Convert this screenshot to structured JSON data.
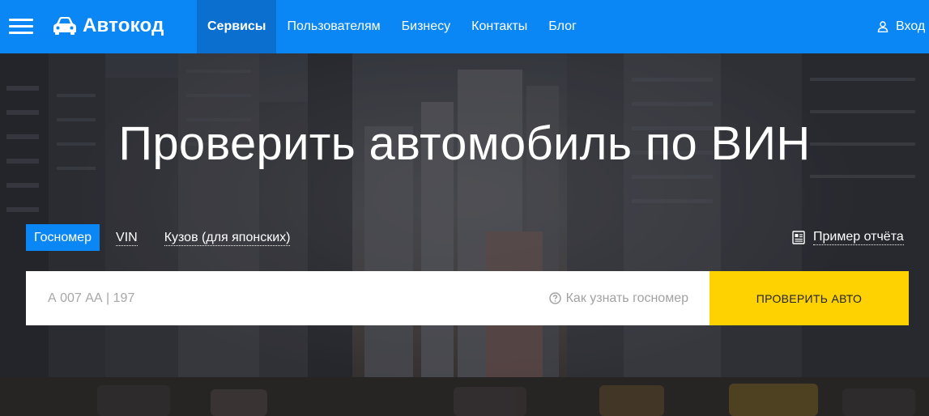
{
  "header": {
    "brand": "Автокод",
    "nav": [
      {
        "label": "Сервисы",
        "active": true
      },
      {
        "label": "Пользователям",
        "active": false
      },
      {
        "label": "Бизнесу",
        "active": false
      },
      {
        "label": "Контакты",
        "active": false
      },
      {
        "label": "Блог",
        "active": false
      }
    ],
    "login_label": "Вход",
    "background_color": "#0b87f5"
  },
  "hero": {
    "title": "Проверить автомобиль по ВИН",
    "tabs": [
      {
        "label": "Госномер",
        "active": true
      },
      {
        "label": "VIN",
        "active": false
      },
      {
        "label": "Кузов (для японских)",
        "active": false
      }
    ],
    "sample_report_label": "Пример отчёта",
    "search": {
      "placeholder": "А 007 АА | 197",
      "hint": "Как узнать госномер",
      "button_label": "ПРОВЕРИТЬ АВТО"
    }
  },
  "icons": {
    "menu": "hamburger-icon",
    "logo": "car-icon",
    "login": "user-icon",
    "sample": "report-icon",
    "hint": "question-circle-icon"
  },
  "colors": {
    "accent": "#0b87f5",
    "active_nav": "#0a6fcf",
    "button": "#fed200"
  }
}
